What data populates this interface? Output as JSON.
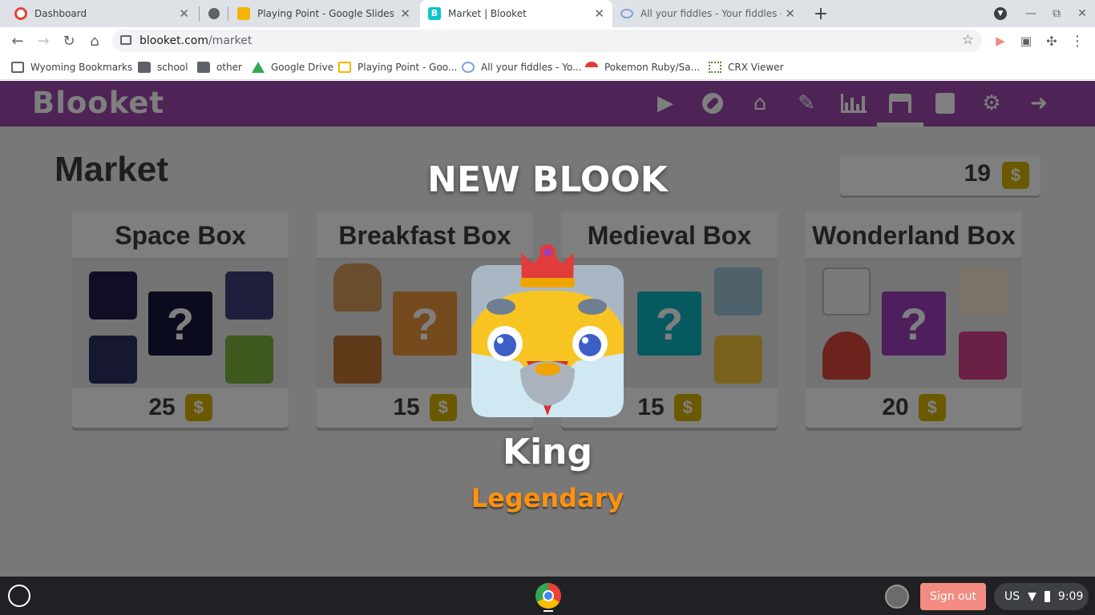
{
  "browser": {
    "tabs": [
      {
        "title": "Dashboard",
        "favicon": "dashboard-favicon"
      },
      {
        "title": "",
        "favicon": "circle-favicon"
      },
      {
        "title": "Playing Point - Google Slides",
        "favicon": "slides-favicon"
      },
      {
        "title": "Market | Blooket",
        "favicon": "blooket-favicon",
        "active": true
      },
      {
        "title": "All your fiddles - Your fiddles - JS",
        "favicon": "jsfiddle-favicon"
      }
    ],
    "url_domain": "blooket.com",
    "url_path": "/market",
    "bookmarks": [
      {
        "label": "Wyoming Bookmarks",
        "icon": "bookmarks-icon"
      },
      {
        "label": "school",
        "icon": "folder-icon"
      },
      {
        "label": "other",
        "icon": "folder-icon"
      },
      {
        "label": "Google Drive",
        "icon": "drive-icon"
      },
      {
        "label": "Playing Point - Goo...",
        "icon": "slides-icon"
      },
      {
        "label": "All your fiddles - Yo...",
        "icon": "jsfiddle-icon"
      },
      {
        "label": "Pokemon Ruby/Sa...",
        "icon": "pokemon-icon"
      },
      {
        "label": "CRX Viewer",
        "icon": "crx-icon"
      }
    ]
  },
  "app": {
    "logo": "Blooket",
    "nav_icons": [
      "play-icon",
      "discover-icon",
      "home-icon",
      "create-icon",
      "stats-icon",
      "market-icon",
      "blooks-icon",
      "settings-icon",
      "logout-icon"
    ],
    "page_title": "Market",
    "tokens": "19",
    "token_symbol": "$",
    "boxes": [
      {
        "name": "Space Box",
        "price": "25",
        "color": "#14163a"
      },
      {
        "name": "Breakfast Box",
        "price": "15",
        "color": "#e8953b"
      },
      {
        "name": "Medieval Box",
        "price": "15",
        "color": "#0fb3c0"
      },
      {
        "name": "Wonderland Box",
        "price": "20",
        "color": "#9b3fb8"
      }
    ],
    "mystery_symbol": "?"
  },
  "modal": {
    "heading": "NEW BLOOK",
    "blook_name": "King",
    "rarity": "Legendary",
    "rarity_color": "#ff910f"
  },
  "taskbar": {
    "signout": "Sign out",
    "locale": "US",
    "time": "9:09"
  }
}
